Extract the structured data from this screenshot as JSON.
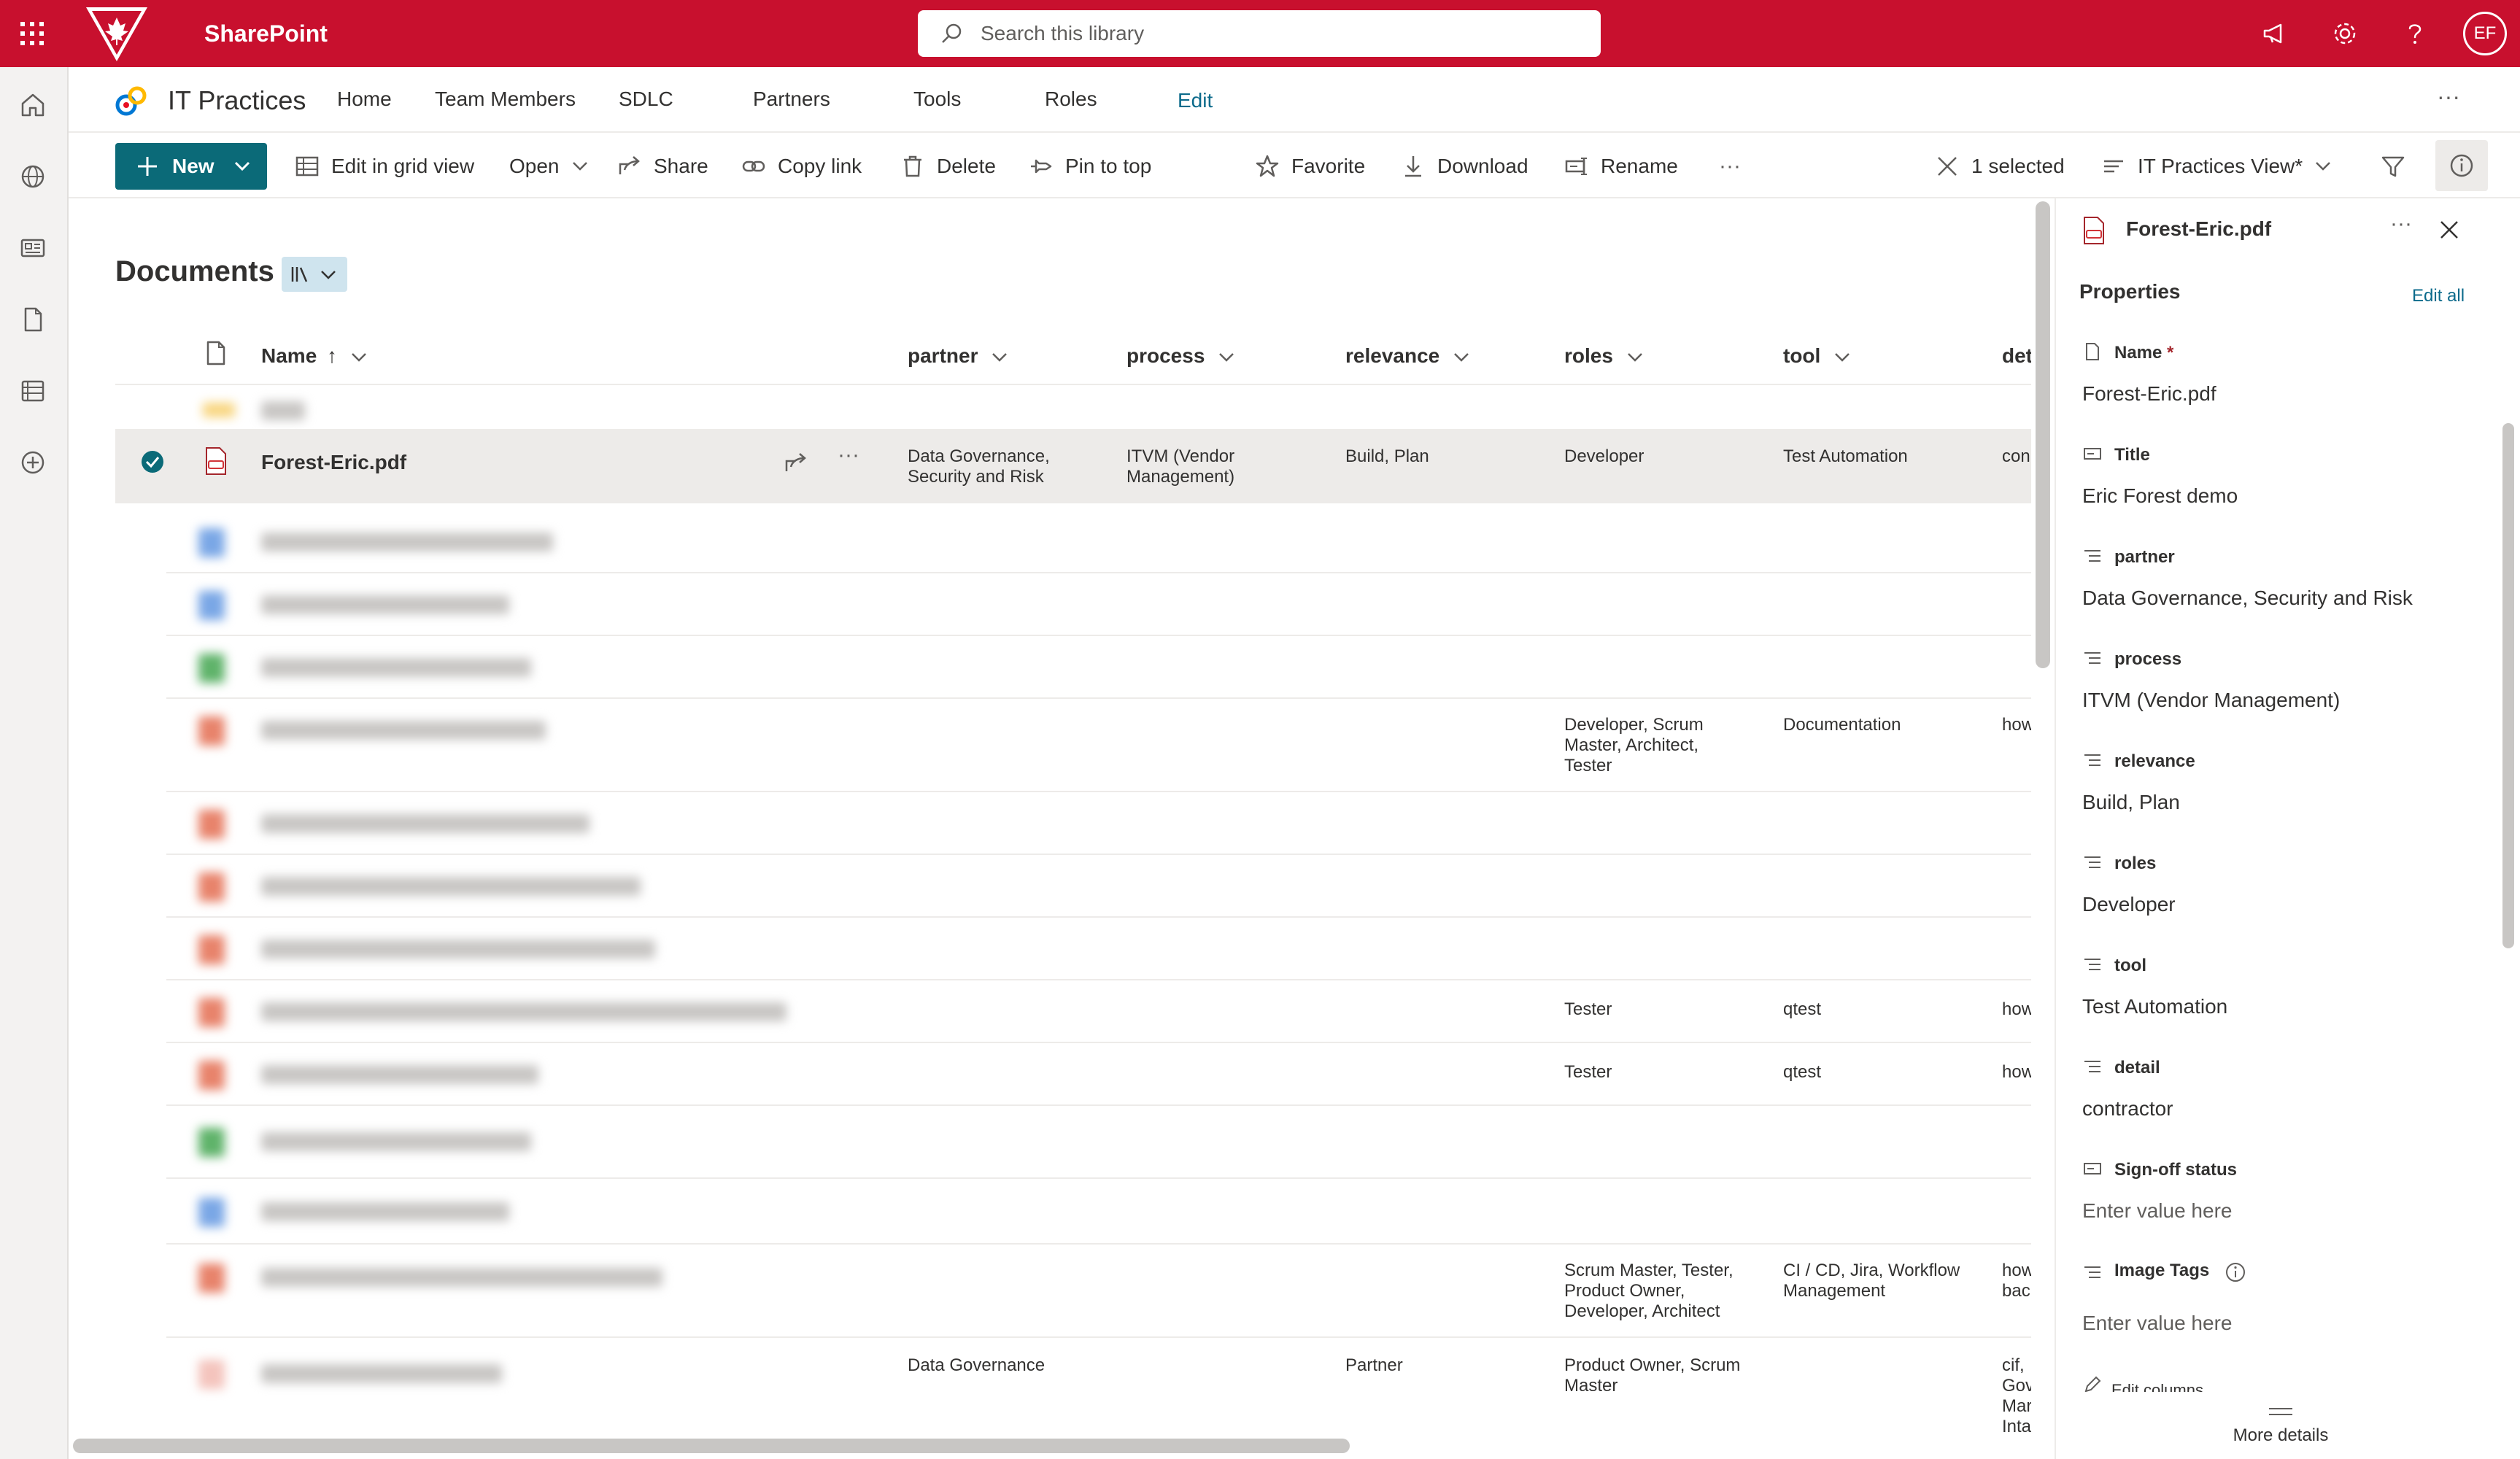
{
  "suite": {
    "app_name": "SharePoint",
    "avatar_initials": "EF"
  },
  "search": {
    "placeholder": "Search this library"
  },
  "site": {
    "title": "IT Practices",
    "nav": [
      "Home",
      "Team Members",
      "SDLC",
      "Partners",
      "Tools",
      "Roles"
    ],
    "edit_label": "Edit",
    "more": "···"
  },
  "commands": {
    "new": "New",
    "edit_grid": "Edit in grid view",
    "open": "Open",
    "share": "Share",
    "copy_link": "Copy link",
    "delete": "Delete",
    "pin": "Pin to top",
    "favorite": "Favorite",
    "download": "Download",
    "rename": "Rename",
    "more": "···",
    "selected_count": "1 selected",
    "view_name": "IT Practices View*"
  },
  "library": {
    "title": "Documents",
    "columns": {
      "name": "Name",
      "name_sort": "↑",
      "partner": "partner",
      "process": "process",
      "relevance": "relevance",
      "roles": "roles",
      "tool": "tool",
      "detail": "det"
    },
    "selected_row": {
      "name": "Forest-Eric.pdf",
      "partner": [
        "Data Governance,",
        "Security and Risk"
      ],
      "process": [
        "ITVM (Vendor",
        "Management)"
      ],
      "relevance": "Build, Plan",
      "roles": "Developer",
      "tool": "Test Automation",
      "detail": "con",
      "more": "···"
    },
    "rows": [
      {
        "roles": [
          "Developer, Scrum",
          "Master, Architect,",
          "Tester"
        ],
        "tool": [
          "Documentation"
        ],
        "detail": [
          "how"
        ]
      },
      {
        "roles": [
          "Tester"
        ],
        "tool": [
          "qtest"
        ],
        "detail": [
          "how"
        ]
      },
      {
        "roles": [
          "Tester"
        ],
        "tool": [
          "qtest"
        ],
        "detail": [
          "how"
        ]
      },
      {
        "roles": [
          "Scrum Master, Tester,",
          "Product Owner,",
          "Developer, Architect"
        ],
        "tool": [
          "CI / CD, Jira, Workflow",
          "Management"
        ],
        "detail": [
          "how",
          "bac"
        ]
      },
      {
        "partner": [
          "Data Governance"
        ],
        "relevance": [
          "Partner"
        ],
        "roles": [
          "Product Owner, Scrum",
          "Master"
        ],
        "detail": [
          "cif,",
          "Gov",
          "Mar",
          "Inta"
        ]
      }
    ]
  },
  "details": {
    "file_name": "Forest-Eric.pdf",
    "more": "···",
    "section": "Properties",
    "edit_all": "Edit all",
    "required_mark": "*",
    "fields": [
      {
        "label": "Name",
        "value": "Forest-Eric.pdf"
      },
      {
        "label": "Title",
        "value": "Eric Forest demo"
      },
      {
        "label": "partner",
        "value": "Data Governance, Security and Risk"
      },
      {
        "label": "process",
        "value": "ITVM (Vendor Management)"
      },
      {
        "label": "relevance",
        "value": "Build, Plan"
      },
      {
        "label": "roles",
        "value": "Developer"
      },
      {
        "label": "tool",
        "value": "Test Automation"
      },
      {
        "label": "detail",
        "value": "contractor"
      },
      {
        "label": "Sign-off status",
        "placeholder": "Enter value here"
      },
      {
        "label": "Image Tags",
        "placeholder": "Enter value here"
      }
    ],
    "edit_columns": "Edit columns",
    "more_details": "More details"
  },
  "colors": {
    "suite_bar": "#c8102e",
    "new_button": "#0b6a78",
    "link": "#0b6a8b"
  }
}
